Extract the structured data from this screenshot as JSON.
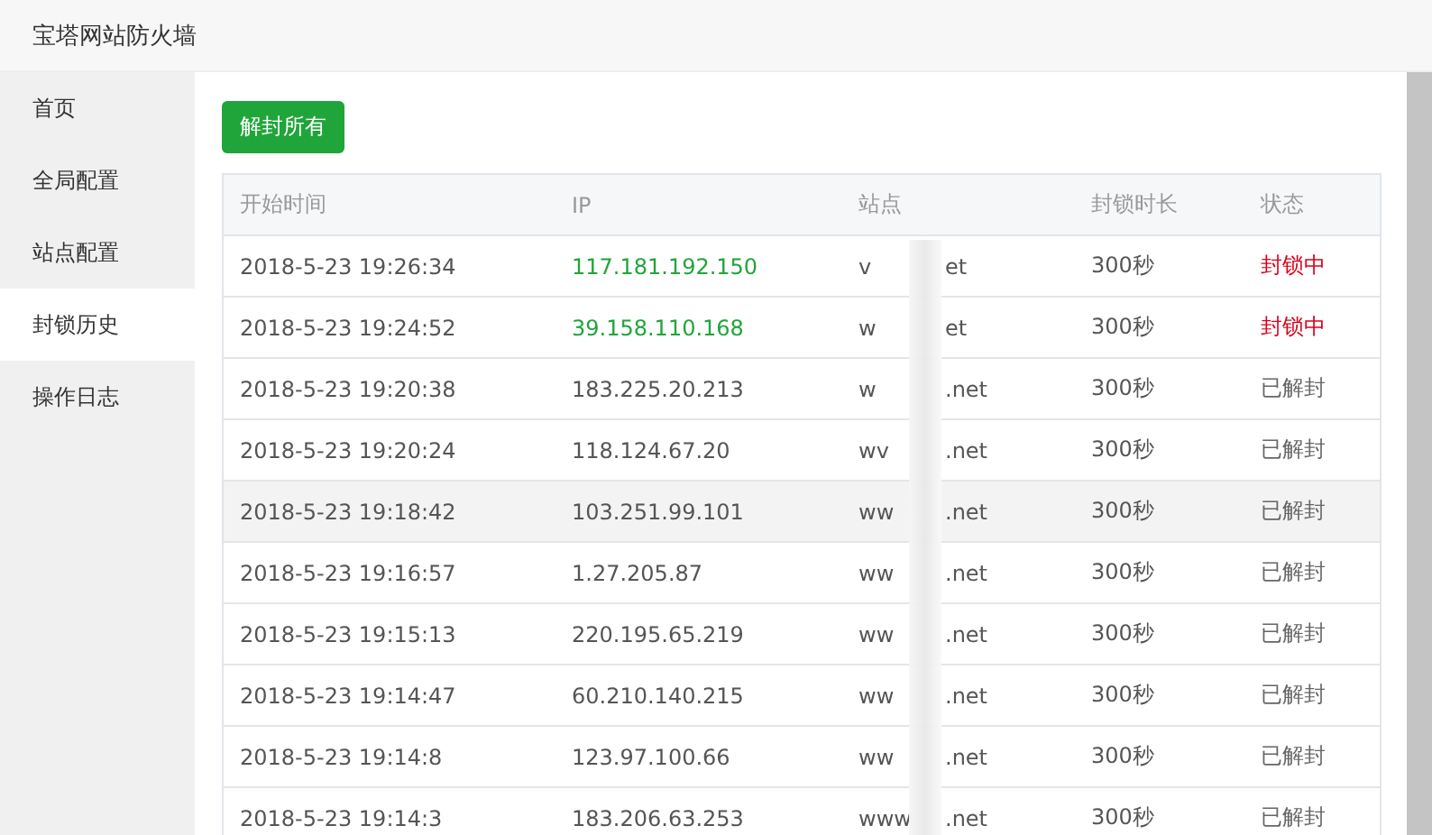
{
  "window": {
    "title": "宝塔网站防火墙"
  },
  "sidebar": {
    "items": [
      {
        "label": "首页",
        "selected": false
      },
      {
        "label": "全局配置",
        "selected": false
      },
      {
        "label": "站点配置",
        "selected": false
      },
      {
        "label": "封锁历史",
        "selected": true
      },
      {
        "label": "操作日志",
        "selected": false
      }
    ]
  },
  "toolbar": {
    "button": "解封所有"
  },
  "table": {
    "columns": [
      "开始时间",
      "IP",
      "站点",
      "封锁时长",
      "状态"
    ],
    "rows": [
      {
        "time": "2018-5-23 19:26:34",
        "ip": "117.181.192.150",
        "site_start": "v",
        "site_end": "et",
        "duration": "300秒",
        "status": "封锁中",
        "blocked": true,
        "hovered": false
      },
      {
        "time": "2018-5-23 19:24:52",
        "ip": "39.158.110.168",
        "site_start": "w",
        "site_end": "et",
        "duration": "300秒",
        "status": "封锁中",
        "blocked": true,
        "hovered": false
      },
      {
        "time": "2018-5-23 19:20:38",
        "ip": "183.225.20.213",
        "site_start": "w",
        "site_end": ".net",
        "duration": "300秒",
        "status": "已解封",
        "blocked": false,
        "hovered": false
      },
      {
        "time": "2018-5-23 19:20:24",
        "ip": "118.124.67.20",
        "site_start": "wv",
        "site_end": ".net",
        "duration": "300秒",
        "status": "已解封",
        "blocked": false,
        "hovered": false
      },
      {
        "time": "2018-5-23 19:18:42",
        "ip": "103.251.99.101",
        "site_start": "ww",
        "site_end": ".net",
        "duration": "300秒",
        "status": "已解封",
        "blocked": false,
        "hovered": true
      },
      {
        "time": "2018-5-23 19:16:57",
        "ip": "1.27.205.87",
        "site_start": "ww",
        "site_end": ".net",
        "duration": "300秒",
        "status": "已解封",
        "blocked": false,
        "hovered": false
      },
      {
        "time": "2018-5-23 19:15:13",
        "ip": "220.195.65.219",
        "site_start": "ww",
        "site_end": ".net",
        "duration": "300秒",
        "status": "已解封",
        "blocked": false,
        "hovered": false
      },
      {
        "time": "2018-5-23 19:14:47",
        "ip": "60.210.140.215",
        "site_start": "ww",
        "site_end": ".net",
        "duration": "300秒",
        "status": "已解封",
        "blocked": false,
        "hovered": false
      },
      {
        "time": "2018-5-23 19:14:8",
        "ip": "123.97.100.66",
        "site_start": "ww",
        "site_end": ".net",
        "duration": "300秒",
        "status": "已解封",
        "blocked": false,
        "hovered": false
      },
      {
        "time": "2018-5-23 19:14:3",
        "ip": "183.206.63.253",
        "site_start": "www",
        "site_end": ".net",
        "duration": "300秒",
        "status": "已解封",
        "blocked": false,
        "hovered": false
      }
    ]
  }
}
